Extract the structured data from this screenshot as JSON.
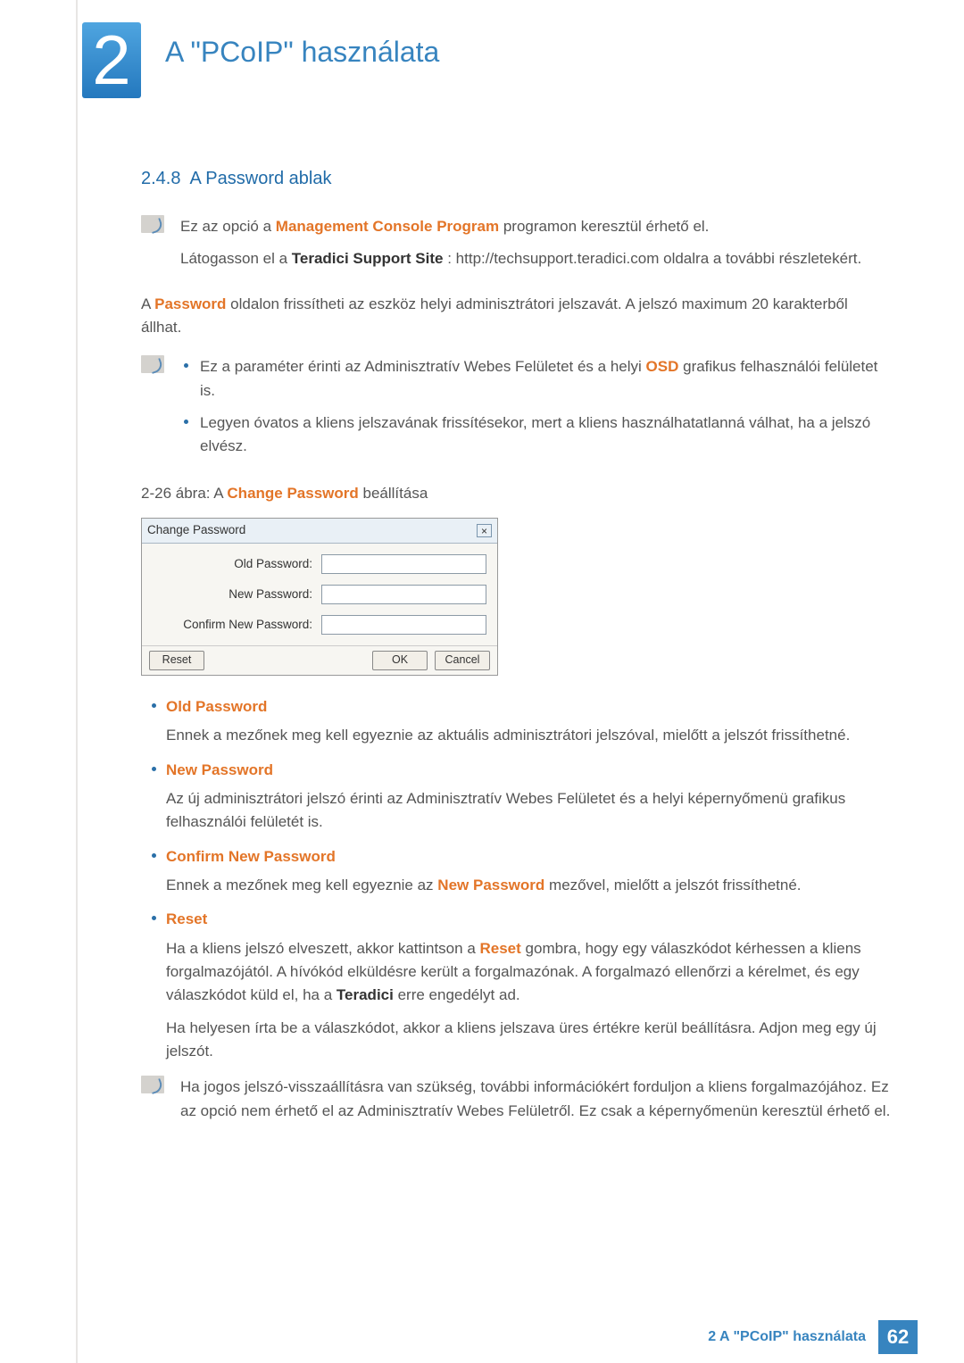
{
  "chapter": {
    "number": "2",
    "title": "A \"PCoIP\" használata"
  },
  "section": {
    "id": "2.4.8",
    "title": "A Password ablak"
  },
  "note1": {
    "line1_pre": "Ez az opció a ",
    "line1_b": "Management Console Program",
    "line1_post": " programon keresztül érhető el.",
    "line2_pre": "Látogasson el a ",
    "line2_b": "Teradici Support Site",
    "line2_post": ": http://techsupport.teradici.com oldalra a további részletekért."
  },
  "para1": {
    "pre": "A ",
    "b": "Password",
    "post": " oldalon frissítheti az eszköz helyi adminisztrátori jelszavát. A jelszó maximum 20 karakterből állhat."
  },
  "note2": {
    "b1_pre": "Ez a paraméter érinti az Adminisztratív Webes Felületet és a helyi ",
    "b1_b": "OSD",
    "b1_post": " grafikus felhasználói felületet is.",
    "b2": "Legyen óvatos a kliens jelszavának frissítésekor, mert a kliens használhatatlanná válhat, ha a jelszó elvész."
  },
  "figcap": {
    "pre": "2-26 ábra: A ",
    "b": "Change Password",
    "post": " beállítása"
  },
  "dialog": {
    "title": "Change Password",
    "close": "×",
    "old": "Old Password:",
    "new": "New Password:",
    "confirm": "Confirm New Password:",
    "reset": "Reset",
    "ok": "OK",
    "cancel": "Cancel"
  },
  "defs": {
    "old_h": "Old Password",
    "old_b": "Ennek a mezőnek meg kell egyeznie az aktuális adminisztrátori jelszóval, mielőtt a jelszót frissíthetné.",
    "new_h": "New Password",
    "new_b": "Az új adminisztrátori jelszó érinti az Adminisztratív Webes Felületet és a helyi képernyőmenü grafikus felhasználói felületét is.",
    "conf_h": "Confirm New Password",
    "conf_b_pre": "Ennek a mezőnek meg kell egyeznie az ",
    "conf_b_b": "New Password",
    "conf_b_post": " mezővel, mielőtt a jelszót frissíthetné.",
    "reset_h": "Reset",
    "reset_b1_pre": "Ha a kliens jelszó elveszett, akkor kattintson a ",
    "reset_b1_b1": "Reset",
    "reset_b1_mid": " gombra, hogy egy válaszkódot kérhessen a kliens forgalmazójától. A hívókód elküldésre került a forgalmazónak. A forgalmazó ellenőrzi a kérelmet, és egy válaszkódot küld el, ha a ",
    "reset_b1_b2": "Teradici",
    "reset_b1_post": " erre engedélyt ad.",
    "reset_b2": "Ha helyesen írta be a válaszkódot, akkor a kliens jelszava üres értékre kerül beállításra. Adjon meg egy új jelszót."
  },
  "note3": "Ha jogos jelszó-visszaállításra van szükség, további információkért forduljon a kliens forgalmazójához. Ez az opció nem érhető el az Adminisztratív Webes Felületről. Ez csak a képernyőmenün keresztül érhető el.",
  "footer": {
    "text": "2 A \"PCoIP\" használata",
    "page": "62"
  }
}
